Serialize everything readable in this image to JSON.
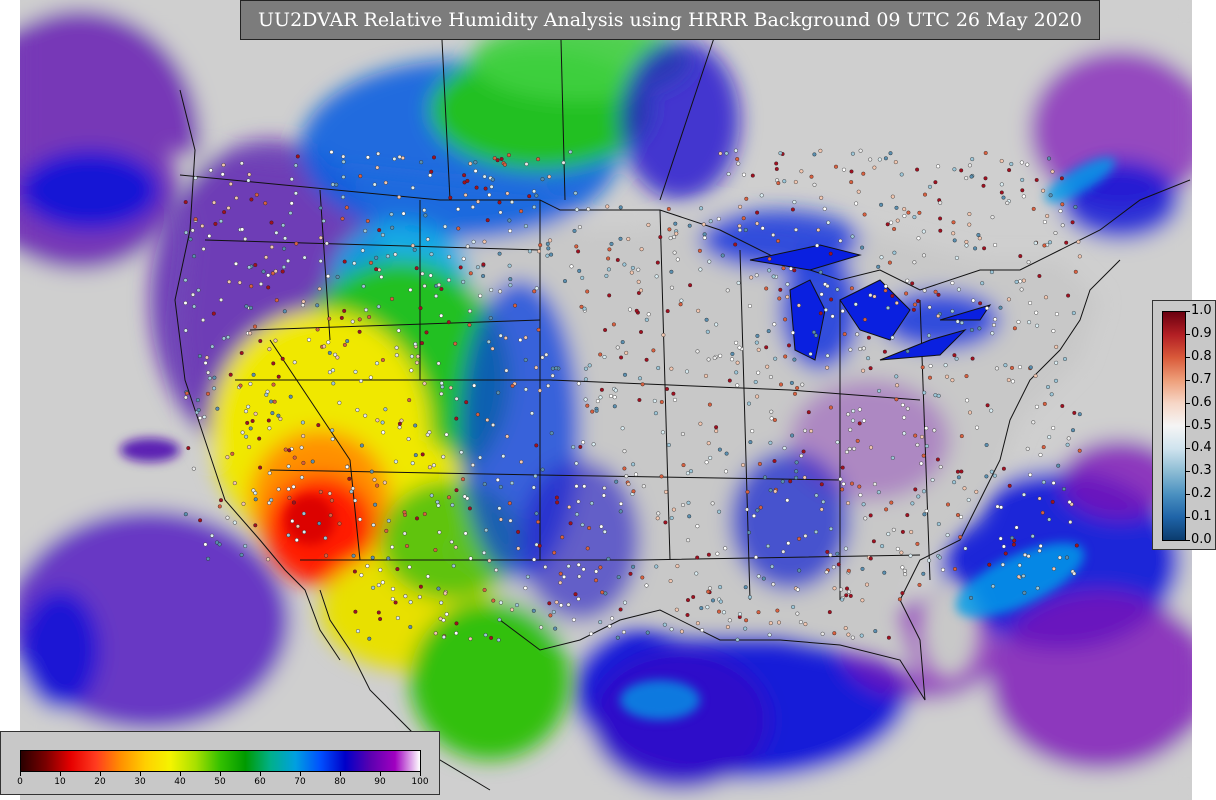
{
  "title": "UU2DVAR Relative Humidity Analysis using HRRR Background 09 UTC 26 May 2020",
  "rh_colorbar": {
    "ticks": [
      "0",
      "10",
      "20",
      "30",
      "40",
      "50",
      "60",
      "70",
      "80",
      "90",
      "100"
    ],
    "range": [
      0,
      100
    ],
    "stops": [
      "#2a0000",
      "#7a0000",
      "#e60000",
      "#ff3b1f",
      "#ff9000",
      "#ffd000",
      "#f4f400",
      "#a8e000",
      "#33c000",
      "#009a00",
      "#00b08a",
      "#00a0e0",
      "#0050ff",
      "#0000c8",
      "#5a00b0",
      "#a000c0",
      "#ffffff"
    ]
  },
  "increment_colorbar": {
    "ticks": [
      "1.0",
      "0.9",
      "0.8",
      "0.7",
      "0.6",
      "0.5",
      "0.4",
      "0.3",
      "0.2",
      "0.1",
      "0.0"
    ],
    "range": [
      0,
      1
    ],
    "stops": [
      "#0b3c6e",
      "#1f64a8",
      "#4a90c0",
      "#8cbcd4",
      "#cfe3ee",
      "#f5f5f5",
      "#f6d6c6",
      "#ee9f7a",
      "#d95a3a",
      "#b31f24",
      "#6b0010"
    ]
  },
  "colors": {
    "ocean_blue": "#0a12d8",
    "ocean_purple": "#7c10b8",
    "ocean_gray": "#cfcfcf",
    "dry_red": "#ff1a00",
    "dry_orange": "#ff9a00",
    "dry_yellow": "#f8ef00",
    "green": "#18c000",
    "cyan": "#00a8e8",
    "land_gray": "#c8c8c8",
    "border": "#111111"
  }
}
